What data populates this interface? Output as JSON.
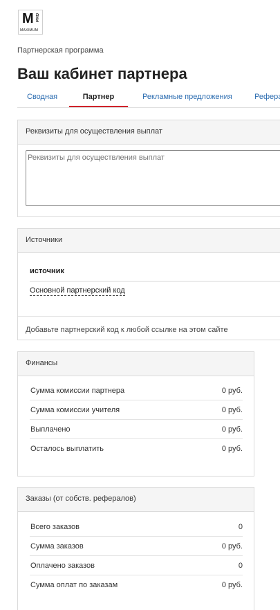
{
  "logo": {
    "letter": "M",
    "pro": "PRO",
    "sub": "MAXIMUM"
  },
  "breadcrumb": "Партнерская программа",
  "title": "Ваш кабинет партнера",
  "tabs": [
    {
      "label": "Сводная"
    },
    {
      "label": "Партнер",
      "active": true
    },
    {
      "label": "Рекламные предложения"
    },
    {
      "label": "Рефера"
    }
  ],
  "payout": {
    "heading": "Реквизиты для осуществления выплат",
    "placeholder": "Реквизиты для осуществления выплат"
  },
  "sources": {
    "heading": "Источники",
    "column": "источник",
    "link": "Основной партнерский код",
    "hint": "Добавьте партнерский код к любой ссылке на этом сайте"
  },
  "finance": {
    "heading": "Финансы",
    "rows": [
      {
        "label": "Сумма комиссии партнера",
        "value": "0 руб."
      },
      {
        "label": "Сумма комиссии учителя",
        "value": "0 руб."
      },
      {
        "label": "Выплачено",
        "value": "0 руб."
      },
      {
        "label": "Осталось выплатить",
        "value": "0 руб."
      }
    ]
  },
  "orders": {
    "heading": "Заказы (от собств. рефералов)",
    "rows": [
      {
        "label": "Всего заказов",
        "value": "0"
      },
      {
        "label": "Сумма заказов",
        "value": "0 руб."
      },
      {
        "label": "Оплачено заказов",
        "value": "0"
      },
      {
        "label": "Сумма оплат по заказам",
        "value": "0 руб."
      }
    ]
  }
}
